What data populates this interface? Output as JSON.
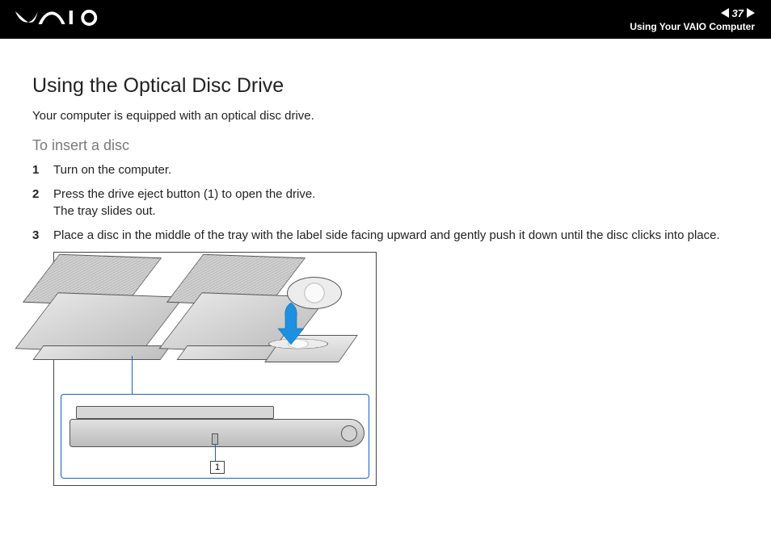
{
  "header": {
    "page_number": "37",
    "section": "Using Your VAIO Computer"
  },
  "page": {
    "title": "Using the Optical Disc Drive",
    "intro": "Your computer is equipped with an optical disc drive.",
    "subhead": "To insert a disc"
  },
  "steps": [
    {
      "num": "1",
      "text": "Turn on the computer."
    },
    {
      "num": "2",
      "text": "Press the drive eject button (1) to open the drive.\nThe tray slides out."
    },
    {
      "num": "3",
      "text": "Place a disc in the middle of the tray with the label side facing upward and gently push it down until the disc clicks into place."
    }
  ],
  "figure": {
    "callout": "1"
  }
}
